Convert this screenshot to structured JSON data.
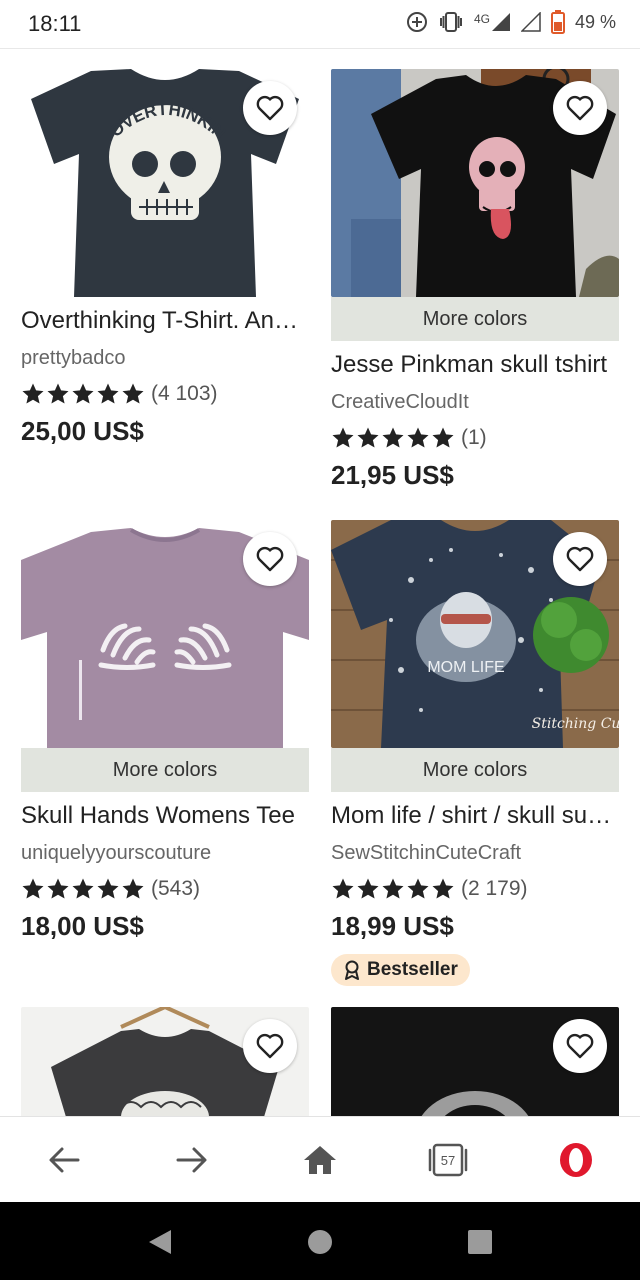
{
  "status_bar": {
    "time": "18:11",
    "network": "4G",
    "battery": "49 %"
  },
  "products": [
    {
      "title": "Overthinking T-Shirt. Anxiety Shirt",
      "shop": "prettybadco",
      "rating": 5,
      "reviews": "(4 103)",
      "price": "25,00 US$",
      "more_colors": "",
      "shirt_text": "OVERTHINKING"
    },
    {
      "title": "Jesse Pinkman skull tshirt",
      "shop": "CreativeCloudIt",
      "rating": 5,
      "reviews": "(1)",
      "price": "21,95 US$",
      "more_colors": "More colors"
    },
    {
      "title": "Skull Hands Womens Tee",
      "shop": "uniquelyyourscouture",
      "rating": 5,
      "reviews": "(543)",
      "price": "18,00 US$",
      "more_colors": "More colors"
    },
    {
      "title": "Mom life / shirt / skull sunglasses",
      "shop": "SewStitchinCuteCraft",
      "rating": 5,
      "reviews": "(2 179)",
      "price": "18,99 US$",
      "more_colors": "More colors",
      "badge": "Bestseller",
      "shirt_text": "MOM LIFE",
      "watermark": "Stitching Cute"
    }
  ],
  "bottom_nav": {
    "tabs_count": "57",
    "items": [
      "back-icon",
      "forward-icon",
      "home-icon",
      "tabs-icon",
      "opera-icon"
    ]
  },
  "colors": {
    "more_colors_bg": "#e1e4de",
    "badge_bg": "#fde7cd",
    "opera_red": "#e0182d"
  }
}
